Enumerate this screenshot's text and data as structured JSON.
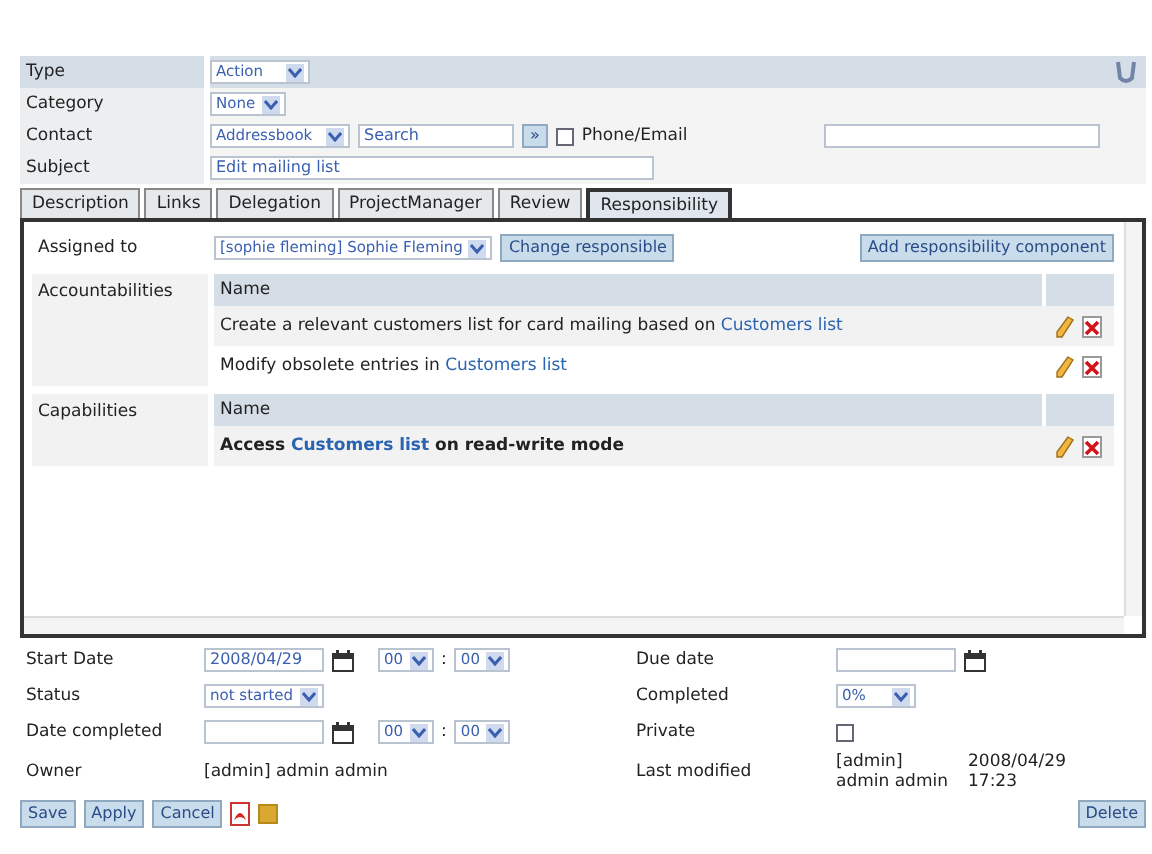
{
  "header": {
    "type": {
      "label": "Type",
      "value": "Action"
    },
    "category": {
      "label": "Category",
      "value": "None"
    },
    "contact": {
      "label": "Contact",
      "source": "Addressbook",
      "search": "Search",
      "go": "»",
      "phone_email": {
        "label": "Phone/Email",
        "checked": false
      }
    },
    "subject": {
      "label": "Subject",
      "value": "Edit mailing list"
    }
  },
  "tabs": [
    {
      "label": "Description",
      "selected": false
    },
    {
      "label": "Links",
      "selected": false
    },
    {
      "label": "Delegation",
      "selected": false
    },
    {
      "label": "ProjectManager",
      "selected": false
    },
    {
      "label": "Review",
      "selected": false
    },
    {
      "label": "Responsibility",
      "selected": true
    }
  ],
  "responsibility": {
    "assigned_label": "Assigned to",
    "assignee": "[sophie fleming] Sophie Fleming",
    "change_button": "Change responsible",
    "add_button": "Add responsibility component",
    "sections": [
      {
        "label": "Accountabilities",
        "column": "Name",
        "rows": [
          {
            "prefix": "Create a relevant customers list for card mailing based on ",
            "link": "Customers list",
            "suffix": "",
            "bold": false
          },
          {
            "prefix": "Modify obsolete entries in ",
            "link": "Customers list",
            "suffix": "",
            "bold": false
          }
        ]
      },
      {
        "label": "Capabilities",
        "column": "Name",
        "rows": [
          {
            "prefix": "Access ",
            "link": "Customers list",
            "suffix": " on read-write mode",
            "bold": true
          }
        ]
      }
    ]
  },
  "details": [
    [
      {
        "label": "Start Date",
        "kind": "datetime",
        "value": "2008/04/29",
        "hour": "00",
        "separator": ":",
        "minute": "00"
      },
      {
        "label": "Due date",
        "kind": "date"
      }
    ],
    [
      {
        "label": "Status",
        "kind": "select",
        "value": "not started"
      },
      {
        "label": "Completed",
        "kind": "select",
        "value": "0%"
      }
    ],
    [
      {
        "label": "Date completed",
        "kind": "datetime",
        "hour": "00",
        "separator": ":",
        "minute": "00"
      },
      {
        "label": "Private",
        "kind": "checkbox",
        "checked": false
      }
    ],
    [
      {
        "label": "Owner",
        "kind": "text",
        "value": "[admin] admin admin"
      },
      {
        "label": "Last modified",
        "kind": "modified",
        "value": "[admin] admin admin",
        "date": "2008/04/29 17:23"
      }
    ]
  ],
  "buttons": [
    "Save",
    "Apply",
    "Cancel"
  ],
  "delete_button": "Delete"
}
